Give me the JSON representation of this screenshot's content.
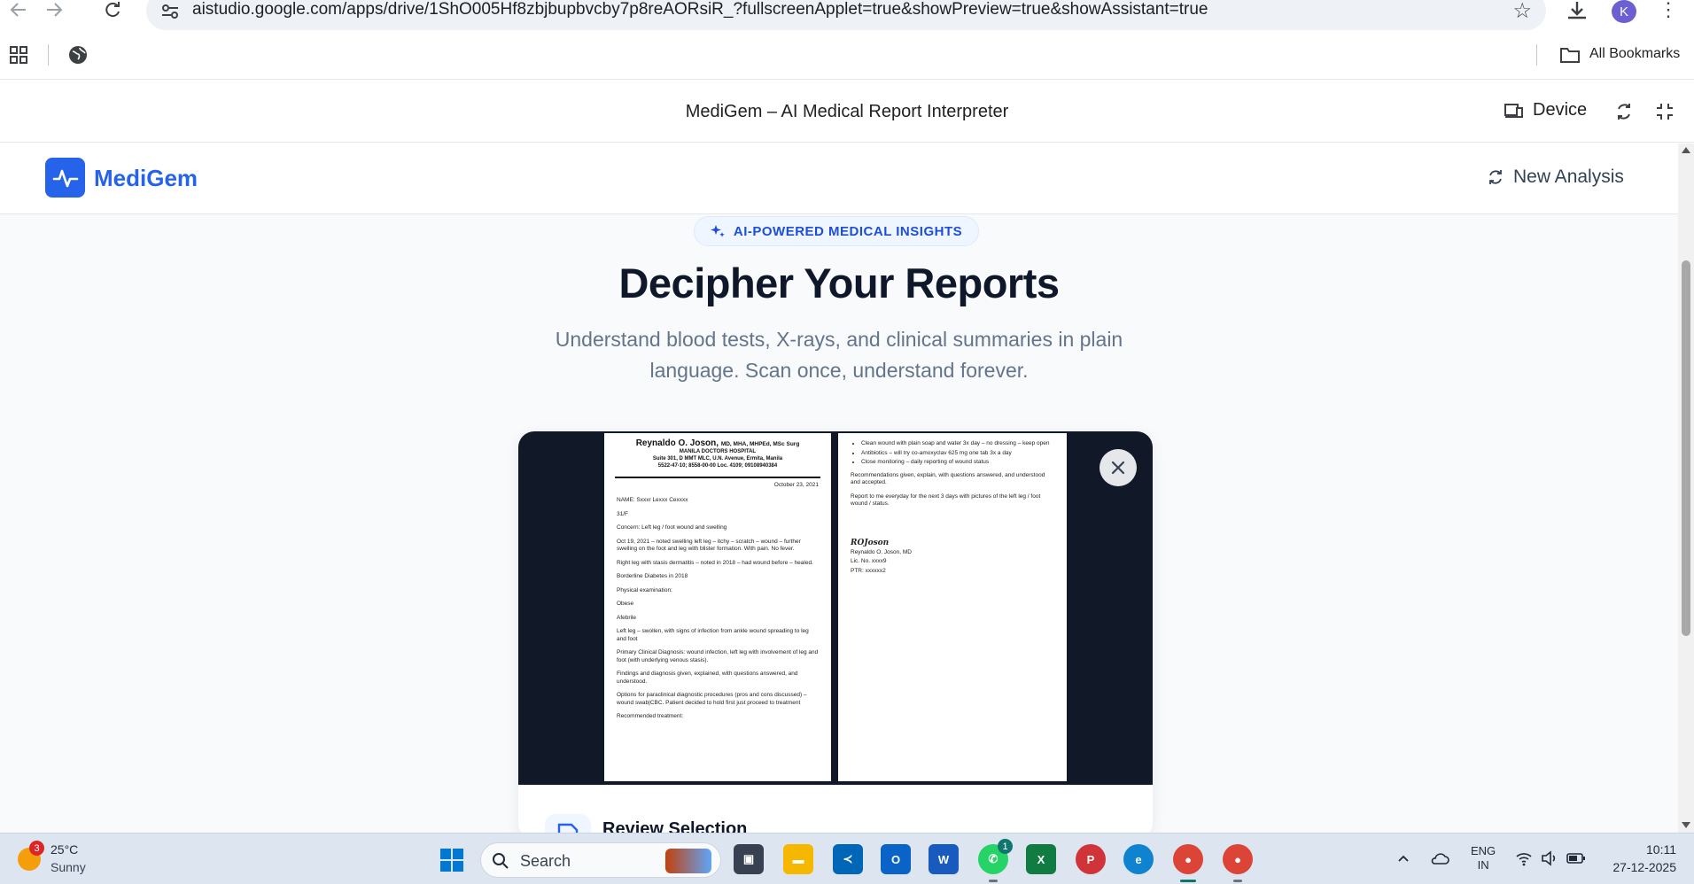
{
  "browser": {
    "url": "aistudio.google.com/apps/drive/1ShO005Hf8zbjbupbvcby7p8reAORsiR_?fullscreenApplet=true&showPreview=true&showAssistant=true",
    "profile_initial": "K",
    "all_bookmarks_label": "All Bookmarks"
  },
  "applet_bar": {
    "title": "MediGem – AI Medical Report Interpreter",
    "device_label": "Device"
  },
  "app": {
    "brand": "MediGem",
    "brand_color": "#2563eb",
    "new_analysis_label": "New Analysis",
    "badge": "AI-POWERED MEDICAL INSIGHTS",
    "hero_title": "Decipher Your Reports",
    "hero_subtitle": "Understand blood tests, X-rays, and clinical summaries in plain language. Scan once, understand forever.",
    "review_title": "Review Selection"
  },
  "document": {
    "left_page": {
      "doctor": "Reynaldo O. Joson,",
      "credentials": "MD, MHA, MHPEd, MSc Surg",
      "hospital": "MANILA DOCTORS HOSPITAL",
      "address": "Suite 301, D MMT MLC, U.N. Avenue, Ermita, Manila",
      "phone": "5522-47-10; 8558-00-00 Loc. 4109; 09108940384",
      "date": "October 23, 2021",
      "lines": [
        "NAME: Sxxxr Lexxx Cexxxx",
        "31/F",
        "Concern: Left leg / foot wound and swelling",
        "Oct 19, 2021 – noted swelling left leg – itchy – scratch – wound – further swelling on the foot and leg with blister formation. With pain. No fever.",
        "Right leg with stasis dermatitis – noted in 2018 – had wound before – healed.",
        "Borderline Diabetes in 2018",
        "Physical examination:",
        "Obese",
        "Afebrile",
        "Left leg – swollen, with signs of infection from ankle wound spreading to leg and foot",
        "Primary Clinical Diagnosis: wound infection, left leg with involvement of leg and foot (with underlying venous stasis).",
        "Findings and diagnosis given, explained, with questions answered, and understood.",
        "Options for paraclinical diagnostic procedures (pros and cons discussed) – wound swab|CBC. Patient decided to hold first just proceed to treatment",
        "Recommended treatment:"
      ]
    },
    "right_page": {
      "bullets": [
        "Clean wound with plain soap and water 3x day – no dressing – keep open",
        "Antibiotics – will try co-amoxyclav 625 mg one tab 3x a day",
        "Close monitoring – daily reporting of wound status"
      ],
      "lines": [
        "Recommendations given, explain, with questions answered, and understood and accepted.",
        "Report to me everyday for the next 3 days with pictures of the left leg / foot wound / status."
      ],
      "signature": "ROJoson",
      "sig_lines": [
        "Reynaldo O. Joson, MD",
        "Lic. No. xxxx9",
        "PTR: xxxxxx2"
      ]
    }
  },
  "taskbar": {
    "weather_temp": "25°C",
    "weather_cond": "Sunny",
    "weather_badge": "3",
    "search_label": "Search",
    "whatsapp_badge": "1",
    "lang_1": "ENG",
    "lang_2": "IN",
    "time": "10:11",
    "date": "27-12-2025"
  }
}
